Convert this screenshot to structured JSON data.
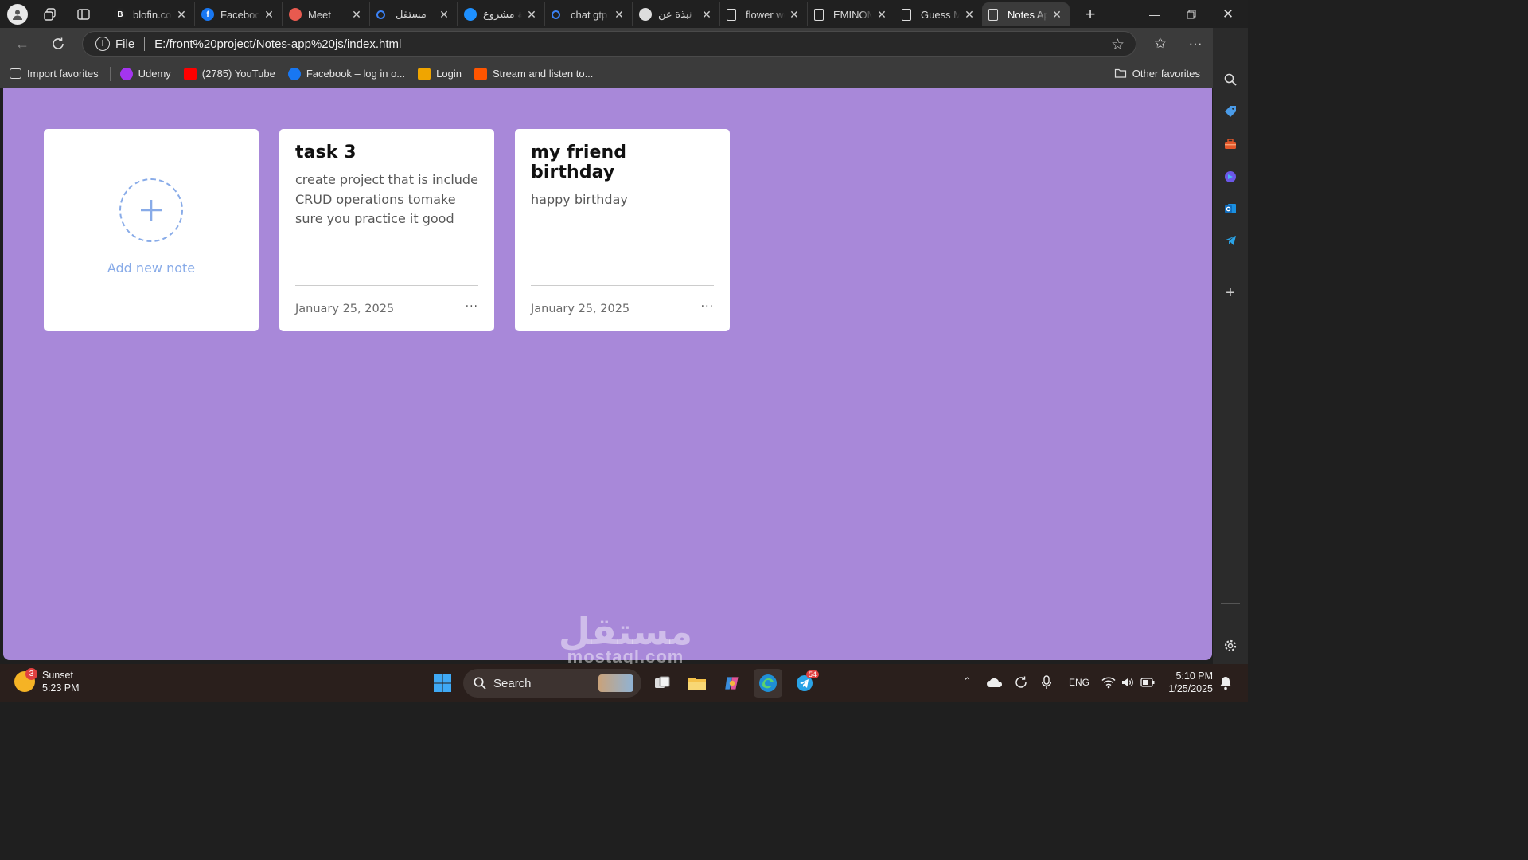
{
  "browser": {
    "tabs": [
      {
        "title": "blofin.com",
        "favicon": "blofin-icon",
        "fav_text": "B",
        "fav_color": "#222222",
        "active": false
      },
      {
        "title": "Facebook",
        "favicon": "facebook-icon",
        "fav_text": "f",
        "fav_color": "#1877f2",
        "active": false
      },
      {
        "title": "Meet",
        "favicon": "meet-icon",
        "fav_text": "",
        "fav_color": "#e85a4f",
        "active": false
      },
      {
        "title": "مستقل",
        "favicon": "search-icon",
        "fav_text": "",
        "fav_color": "#3b82f6",
        "active": false
      },
      {
        "title": "إضافة مشروع",
        "favicon": "mostaql-icon",
        "fav_text": "",
        "fav_color": "#1e90ff",
        "active": false
      },
      {
        "title": "chat gtp",
        "favicon": "search-icon",
        "fav_text": "",
        "fav_color": "#3b82f6",
        "active": false
      },
      {
        "title": "نبذة عن",
        "favicon": "openai-icon",
        "fav_text": "",
        "fav_color": "#dddddd",
        "active": false
      },
      {
        "title": "flower website",
        "favicon": "page-icon",
        "fav_text": "",
        "fav_color": "#dddddd",
        "active": false
      },
      {
        "title": "EMINOM",
        "favicon": "page-icon",
        "fav_text": "",
        "fav_color": "#dddddd",
        "active": false
      },
      {
        "title": "Guess My Number",
        "favicon": "page-icon",
        "fav_text": "",
        "fav_color": "#dddddd",
        "active": false
      },
      {
        "title": "Notes App",
        "favicon": "page-icon",
        "fav_text": "",
        "fav_color": "#dddddd",
        "active": true
      }
    ],
    "address": {
      "scheme": "File",
      "url": "E:/front%20project/Notes-app%20js/index.html"
    },
    "favorites": [
      {
        "label": "Import favorites",
        "icon": "import-favorites-icon",
        "color": ""
      },
      {
        "label": "Udemy",
        "icon": "udemy-icon",
        "color": "#a435f0"
      },
      {
        "label": "(2785) YouTube",
        "icon": "youtube-icon",
        "color": "#ff0000"
      },
      {
        "label": "Facebook – log in o...",
        "icon": "facebook-icon",
        "color": "#1877f2"
      },
      {
        "label": "Login",
        "icon": "login-chart-icon",
        "color": "#f0a500"
      },
      {
        "label": "Stream and listen to...",
        "icon": "soundcloud-icon",
        "color": "#ff5500"
      }
    ],
    "other_favorites": "Other favorites"
  },
  "page": {
    "background": "#a888d9",
    "add_note_label": "Add new note",
    "accent": "#88abe8",
    "notes": [
      {
        "title": "task 3",
        "description": "create project that is include CRUD operations tomake sure you practice it good",
        "date": "January 25, 2025",
        "menu": "···"
      },
      {
        "title": "my friend birthday",
        "description": "happy birthday",
        "date": "January 25, 2025",
        "menu": "···"
      }
    ],
    "watermark": {
      "arabic": "مستقل",
      "latin": "mostaql.com"
    }
  },
  "taskbar": {
    "weather": {
      "label": "Sunset",
      "time": "5:23 PM",
      "badge": "3"
    },
    "search_label": "Search",
    "telegram_badge": "54",
    "language": "ENG",
    "clock": {
      "time": "5:10 PM",
      "date": "1/25/2025"
    }
  }
}
